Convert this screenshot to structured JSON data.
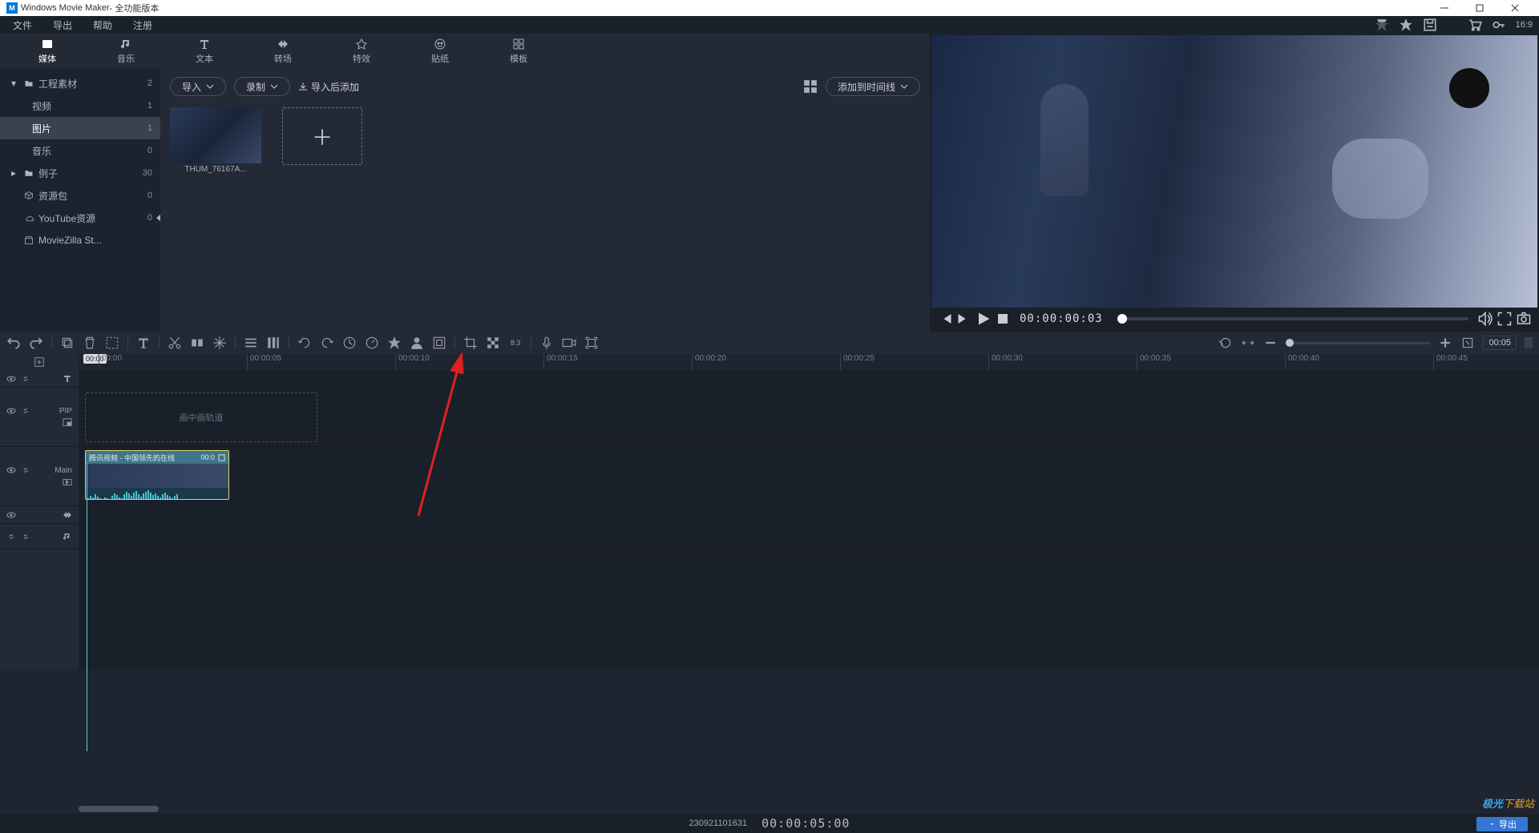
{
  "titlebar": {
    "app_name": "Windows Movie Maker",
    "suffix": " - 全功能版本"
  },
  "menu": {
    "file": "文件",
    "export": "导出",
    "help": "帮助",
    "register": "注册",
    "aspect": "16:9"
  },
  "media_tabs": {
    "media": "媒体",
    "music": "音乐",
    "text": "文本",
    "transition": "转场",
    "effects": "特效",
    "stickers": "贴纸",
    "templates": "模板"
  },
  "sidebar": {
    "project": {
      "label": "工程素材",
      "count": "2"
    },
    "video": {
      "label": "视频",
      "count": "1"
    },
    "image": {
      "label": "图片",
      "count": "1"
    },
    "audio": {
      "label": "音乐",
      "count": "0"
    },
    "examples": {
      "label": "例子",
      "count": "30"
    },
    "resource": {
      "label": "资源包",
      "count": "0"
    },
    "youtube": {
      "label": "YouTube资源",
      "count": "0"
    },
    "mzstore": {
      "label": "MovieZilla St..."
    }
  },
  "media_toolbar": {
    "import": "导入",
    "record": "录制",
    "import_add": "导入后添加",
    "add_timeline": "添加到时间线"
  },
  "thumb": {
    "name": "THUM_76167A..."
  },
  "preview": {
    "timecode": "00:00:00:03"
  },
  "timeline": {
    "dur_box": "00:05"
  },
  "ruler": {
    "t0": "00:00",
    "t1": "00:00:05",
    "t2": "00:00:10",
    "t3": "00:00:15",
    "t4": "00:00:20",
    "t5": "00:00:25",
    "t6": "00:00:30",
    "t7": "00:00:35",
    "t8": "00:00:40",
    "t9": "00:00:45"
  },
  "playhead": {
    "label": "00:00"
  },
  "tracks": {
    "pip_label": "PIP",
    "pip_drop": "画中画轨道",
    "main_label": "Main",
    "clip_name": "腾讯视频 - 中国领先的在线",
    "clip_dur": "00:0"
  },
  "status": {
    "stamp": "230921101631",
    "time": "00:00:05:00",
    "export": "导出"
  },
  "watermark": {
    "w1": "极光",
    "w2": "下载站"
  }
}
